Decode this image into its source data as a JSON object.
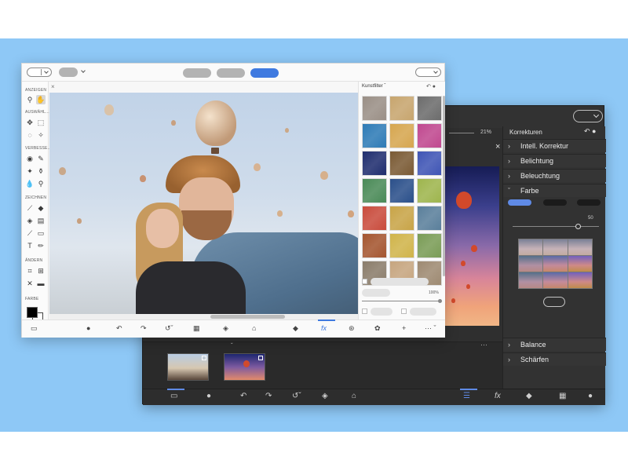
{
  "light_window": {
    "tools_panel": {
      "groups": [
        {
          "label": "ANZEIGEN"
        },
        {
          "label": "AUSWÄHL..."
        },
        {
          "label": "VERBESSE..."
        },
        {
          "label": "ZEICHNEN"
        },
        {
          "label": "ÄNDERN"
        },
        {
          "label": "FARBE"
        }
      ]
    },
    "doc_close": "×",
    "filters_panel": {
      "title": "Kunstfilter",
      "percent": "100%",
      "thumbnail_colors": [
        "#9a8f86",
        "#c7a56e",
        "#6c6c6c",
        "#2e7bb6",
        "#d6a64f",
        "#c0488f",
        "#1f2d6e",
        "#7a5a34",
        "#3f55b5",
        "#4a8a57",
        "#2a4f8a",
        "#9eb54d",
        "#c94b3c",
        "#c8a447",
        "#5a7f9b",
        "#a4552f",
        "#d0b44a",
        "#7a9c56",
        "#8a7c6a",
        "#c6a57f",
        "#9e8a72"
      ]
    },
    "accent_color": "#3f7ae0"
  },
  "dark_window": {
    "zoom": "21%",
    "panel_title": "Korrekturen",
    "sections_top": [
      {
        "label": "Intell. Korrektur"
      },
      {
        "label": "Belichtung"
      },
      {
        "label": "Beleuchtung"
      },
      {
        "label": "Farbe"
      }
    ],
    "slider_value": "50",
    "sections_bottom": [
      {
        "label": "Balance"
      },
      {
        "label": "Schärfen"
      }
    ],
    "canvas_close": "×",
    "accent_color": "#5f8ae6"
  }
}
